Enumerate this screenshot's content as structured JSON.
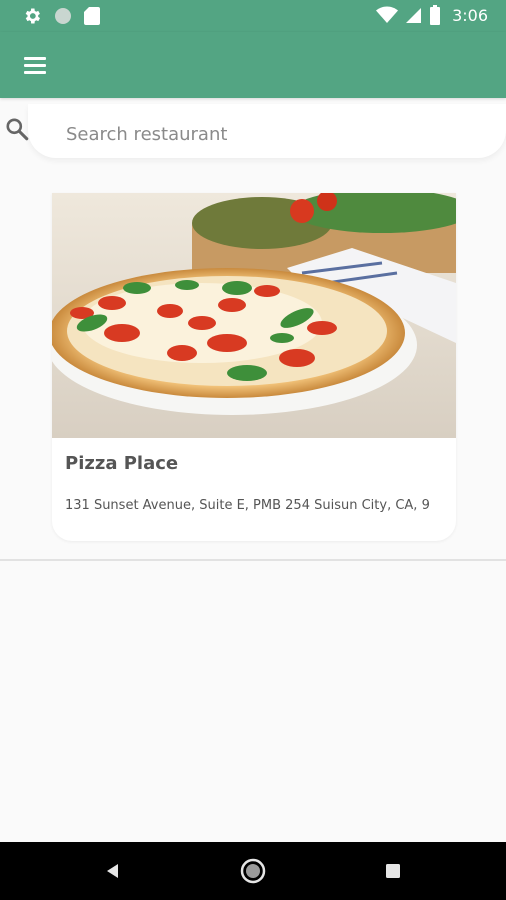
{
  "status_bar": {
    "time": "3:06",
    "icons": [
      "gear-icon",
      "circle-icon",
      "sd-card-icon",
      "wifi-icon",
      "signal-icon",
      "battery-icon"
    ]
  },
  "app_bar": {
    "menu_icon": "hamburger-menu-icon"
  },
  "search": {
    "placeholder": "Search restaurant",
    "value": "",
    "icon": "search-icon"
  },
  "restaurants": [
    {
      "name": "Pizza Place",
      "address": "131 Sunset Avenue, Suite E, PMB 254 Suisun City, CA, 9"
    }
  ],
  "nav_bar": {
    "buttons": [
      "back-icon",
      "home-icon",
      "recents-icon"
    ]
  },
  "colors": {
    "primary": "#53a583",
    "background": "#fafafa",
    "nav_bar": "#000000"
  }
}
